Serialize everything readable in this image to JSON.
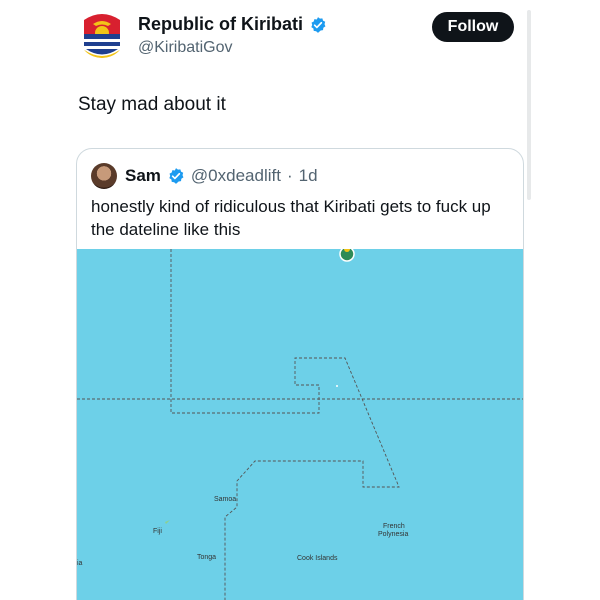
{
  "post": {
    "author_name": "Republic of Kiribati",
    "author_handle": "@KiribatiGov",
    "follow_label": "Follow",
    "text": "Stay mad about it"
  },
  "quote": {
    "author_name": "Sam",
    "author_handle": "@0xdeadlift",
    "separator": "·",
    "time": "1d",
    "text": "honestly kind of ridiculous that Kiribati gets to fuck up the dateline like this"
  },
  "map": {
    "labels": {
      "samoa": "Samoa",
      "fiji": "Fiji",
      "tonga": "Tonga",
      "cook_islands": "Cook Islands",
      "french_polynesia_1": "French",
      "french_polynesia_2": "Polynesia",
      "edge_left": "ia"
    },
    "colors": {
      "ocean": "#6dd0e8",
      "border": "#555555"
    }
  },
  "colors": {
    "verified": "#1d9bf0",
    "follow_bg": "#0f1419",
    "secondary_text": "#536471"
  }
}
